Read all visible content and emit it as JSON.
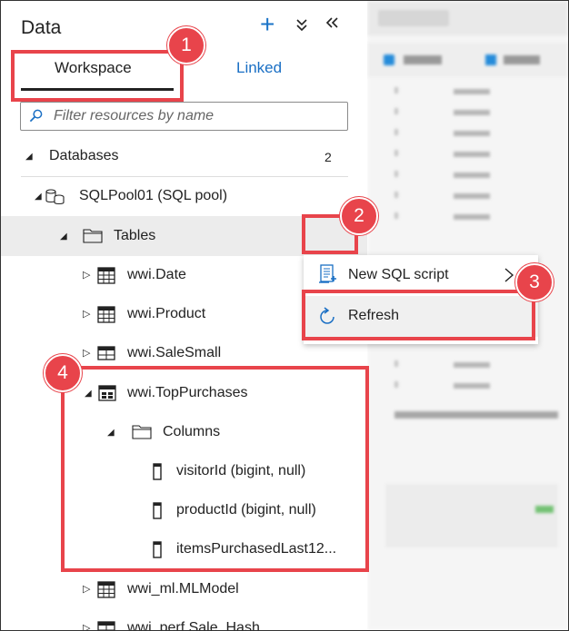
{
  "panel": {
    "title": "Data",
    "tabs": [
      {
        "label": "Workspace",
        "selected": true
      },
      {
        "label": "Linked",
        "selected": false
      }
    ],
    "filter_placeholder": "Filter resources by name",
    "icons": [
      "plus-icon",
      "collapse-all-icon",
      "hide-panel-icon",
      "search-icon"
    ],
    "accent_color": "#1a6fc4"
  },
  "tree": {
    "databases": {
      "label": "Databases",
      "count": "2"
    },
    "pool": {
      "label": "SQLPool01 (SQL pool)"
    },
    "tables": {
      "label": "Tables"
    },
    "items": [
      {
        "label": "wwi.Date"
      },
      {
        "label": "wwi.Product"
      },
      {
        "label": "wwi.SaleSmall"
      },
      {
        "label": "wwi.TopPurchases"
      }
    ],
    "columns_folder": {
      "label": "Columns"
    },
    "columns": [
      {
        "label": "visitorId (bigint, null)"
      },
      {
        "label": "productId (bigint, null)"
      },
      {
        "label": "itemsPurchasedLast12..."
      }
    ],
    "after_items": [
      {
        "label": "wwi_ml.MLModel"
      },
      {
        "label": "wwi_perf.Sale_Hash"
      }
    ]
  },
  "context_menu": {
    "items": [
      {
        "label": "New SQL script",
        "has_submenu": true
      },
      {
        "label": "Refresh"
      }
    ]
  },
  "callouts": {
    "badges": [
      "1",
      "2",
      "3",
      "4"
    ],
    "color": "#e8444b"
  }
}
